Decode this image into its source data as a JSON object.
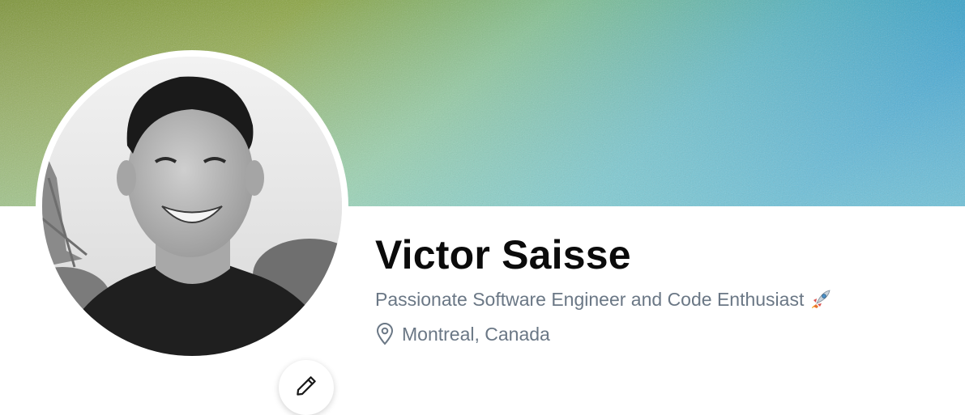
{
  "profile": {
    "name": "Victor Saisse",
    "tagline": "Passionate Software Engineer and Code Enthusiast",
    "tagline_emoji": "rocket-icon",
    "location": "Montreal, Canada",
    "location_icon": "map-pin-icon",
    "edit_icon": "pencil-icon",
    "avatar_alt": "profile-photo"
  },
  "banner": {
    "gradient_start": "#7a9a3a",
    "gradient_mid": "#7fbf8e",
    "gradient_end": "#2f9fc8"
  },
  "colors": {
    "name": "#0b0b0b",
    "secondary_text": "#6a7785",
    "background": "#ffffff"
  }
}
